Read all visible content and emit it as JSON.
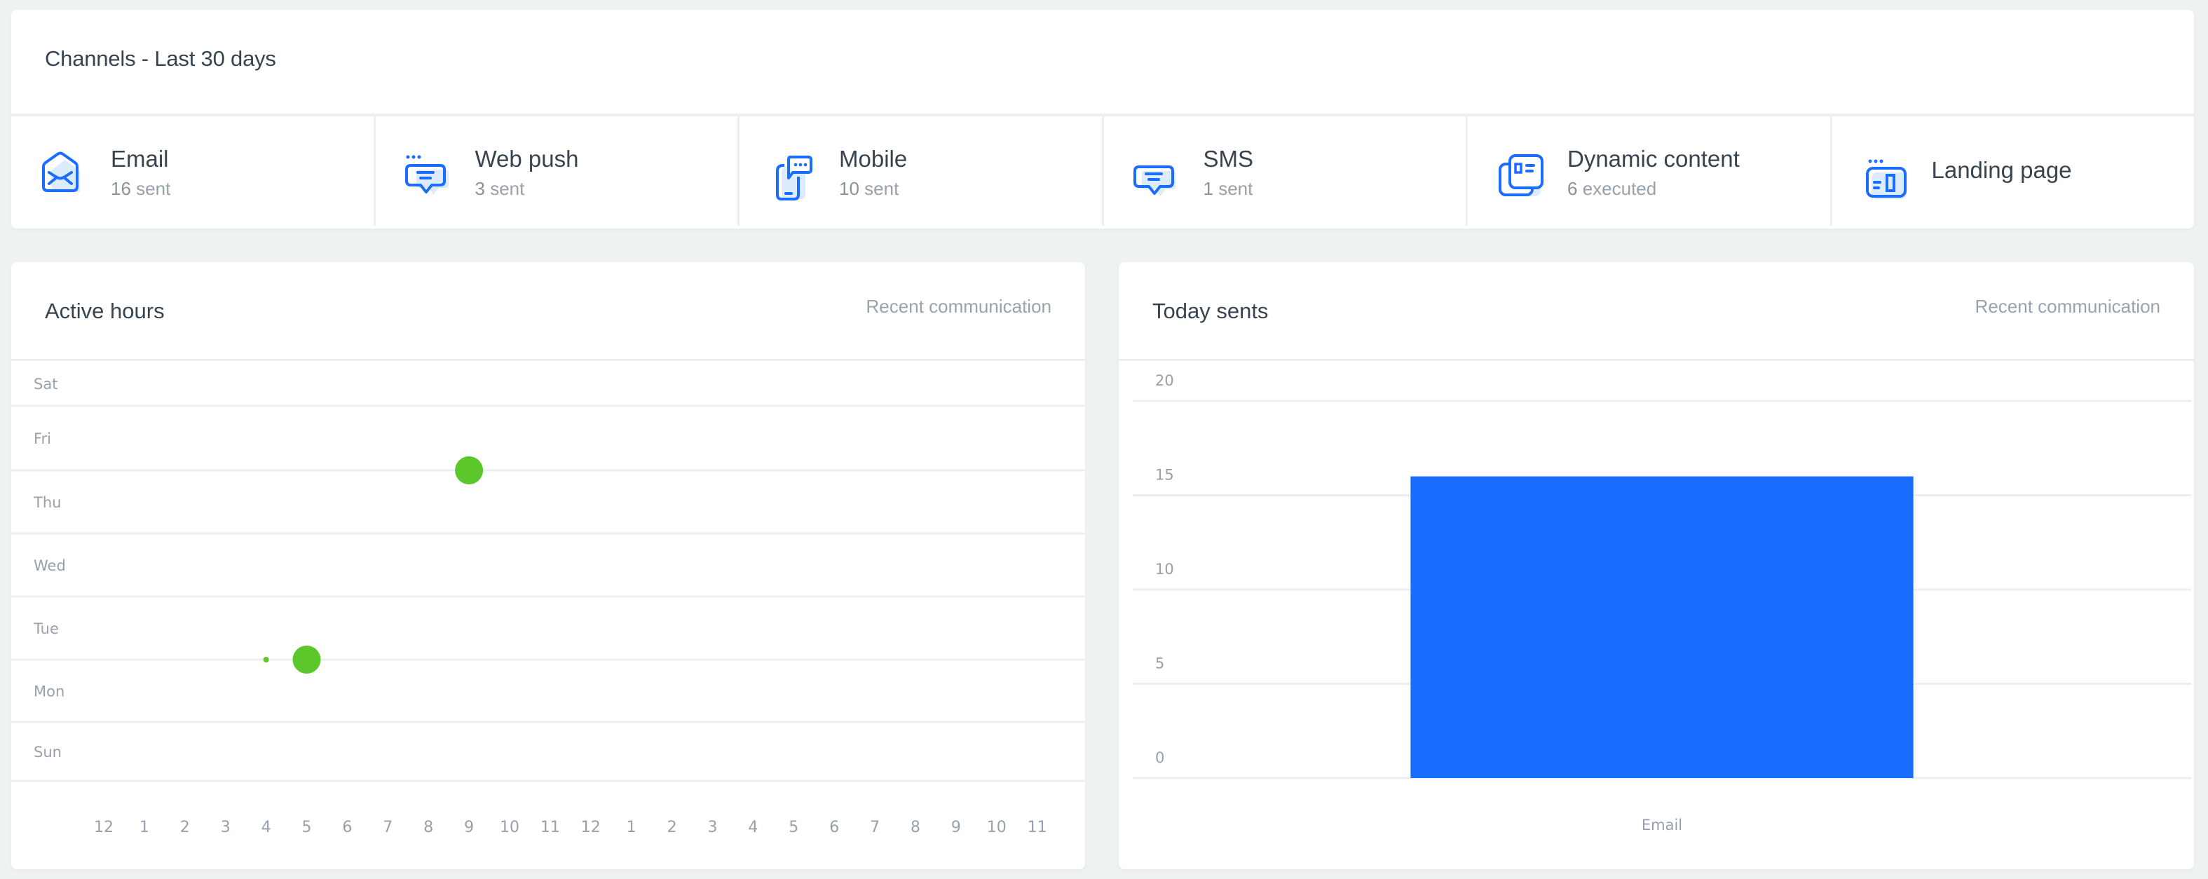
{
  "channels": {
    "title": "Channels - Last 30 days",
    "items": [
      {
        "name": "Email",
        "count": "16",
        "unit": "sent",
        "icon": "email-envelope-icon"
      },
      {
        "name": "Web push",
        "count": "3",
        "unit": "sent",
        "icon": "web-push-icon"
      },
      {
        "name": "Mobile",
        "count": "10",
        "unit": "sent",
        "icon": "mobile-push-icon"
      },
      {
        "name": "SMS",
        "count": "1",
        "unit": "sent",
        "icon": "sms-icon"
      },
      {
        "name": "Dynamic content",
        "count": "6",
        "unit": "executed",
        "icon": "dynamic-content-icon"
      },
      {
        "name": "Landing page",
        "count": null,
        "unit": null,
        "icon": "landing-page-icon"
      }
    ]
  },
  "active_hours": {
    "title": "Active hours",
    "link": "Recent communication"
  },
  "today_sents": {
    "title": "Today sents",
    "link": "Recent communication"
  },
  "colors": {
    "icon_blue": "#1a6dff",
    "icon_fill": "#dcecfd",
    "bubble_green": "#5bc72a",
    "bar_blue": "#1a6dff"
  },
  "chart_data": [
    {
      "type": "scatter",
      "title": "Active hours",
      "xlabel": "",
      "ylabel": "",
      "x_ticks": [
        "12",
        "1",
        "2",
        "3",
        "4",
        "5",
        "6",
        "7",
        "8",
        "9",
        "10",
        "11",
        "12",
        "1",
        "2",
        "3",
        "4",
        "5",
        "6",
        "7",
        "8",
        "9",
        "10",
        "11"
      ],
      "y_ticks": [
        "Sat",
        "Fri",
        "Thu",
        "Wed",
        "Tue",
        "Mon",
        "Sun"
      ],
      "points": [
        {
          "day": "Fri",
          "hour": 9,
          "size": "large"
        },
        {
          "day": "Tue",
          "hour": 4,
          "size": "small"
        },
        {
          "day": "Tue",
          "hour": 5,
          "size": "large"
        }
      ],
      "grid": true
    },
    {
      "type": "bar",
      "title": "Today sents",
      "categories": [
        "Email"
      ],
      "values": [
        16
      ],
      "y_ticks": [
        0,
        5,
        10,
        15,
        20
      ],
      "ylim": [
        0,
        20
      ],
      "xlabel": "",
      "ylabel": "",
      "grid": true
    }
  ]
}
